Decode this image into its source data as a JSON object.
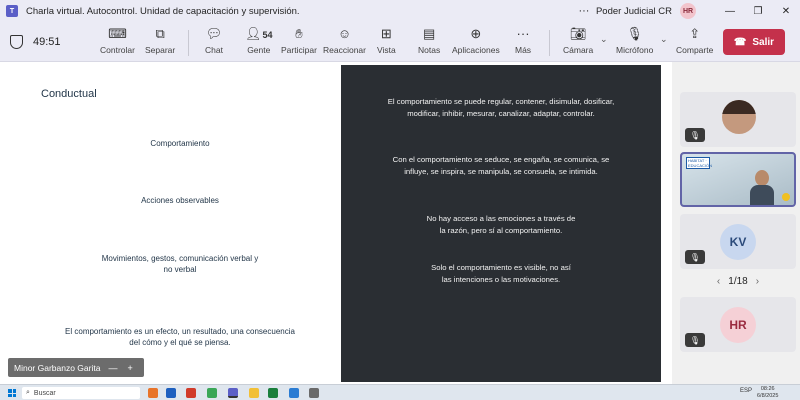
{
  "titlebar": {
    "title": "Charla virtual. Autocontrol. Unidad de capacitación y supervisión.",
    "organization": "Poder Judicial CR",
    "user_initials": "HR",
    "minimize": "—",
    "restore": "❐",
    "close": "✕",
    "more": "···"
  },
  "toolbar": {
    "timer": "49:51",
    "controlar": "Controlar",
    "separar": "Separar",
    "chat": "Chat",
    "gente": "Gente",
    "gente_count": "54",
    "participar": "Participar",
    "reaccionar": "Reaccionar",
    "vista": "Vista",
    "notas": "Notas",
    "aplicaciones": "Aplicaciones",
    "mas": "Más",
    "camara": "Cámara",
    "microfono": "Micrófono",
    "comparte": "Comparte",
    "salir": "Salir"
  },
  "slide": {
    "heading": "Conductual",
    "left_items": [
      "Comportamiento",
      "Acciones observables",
      "Movimientos, gestos, comunicación verbal y no verbal",
      "El comportamiento es un efecto, un resultado, una consecuencia del cómo y el qué se piensa."
    ],
    "right_items": [
      "El comportamiento se puede regular, contener, disimular, dosificar, modificar, inhibir, mesurar, canalizar, adaptar, controlar.",
      "Con el comportamiento se seduce, se engaña, se comunica, se influye, se inspira, se manipula, se consuela, se intimida.",
      "No hay acceso a las emociones a través de la razón, pero sí al comportamiento.",
      "Solo el comportamiento es visible, no así las intenciones o las motivaciones."
    ]
  },
  "speaker": {
    "name": "Minor Garbanzo Garita",
    "minimize": "—",
    "add": "+"
  },
  "participants": {
    "tiles": [
      {
        "type": "photo"
      },
      {
        "type": "camera",
        "banner": "HABITAT · EDUCACIÓN"
      },
      {
        "type": "initials",
        "initials": "KV",
        "bg": "#c8d7ef",
        "fg": "#2b4a7a"
      },
      {
        "type": "initials",
        "initials": "HR",
        "bg": "#f5d0d6",
        "fg": "#9a2b40"
      }
    ],
    "pager": "1/18",
    "prev": "‹",
    "next": "›"
  },
  "taskbar": {
    "search": "Buscar",
    "lang": "ESP",
    "time": "08:26",
    "date": "6/8/2025"
  },
  "colors": {
    "accent": "#6264a7",
    "leave": "#c4314b",
    "slide_dark": "#2a2e33"
  }
}
